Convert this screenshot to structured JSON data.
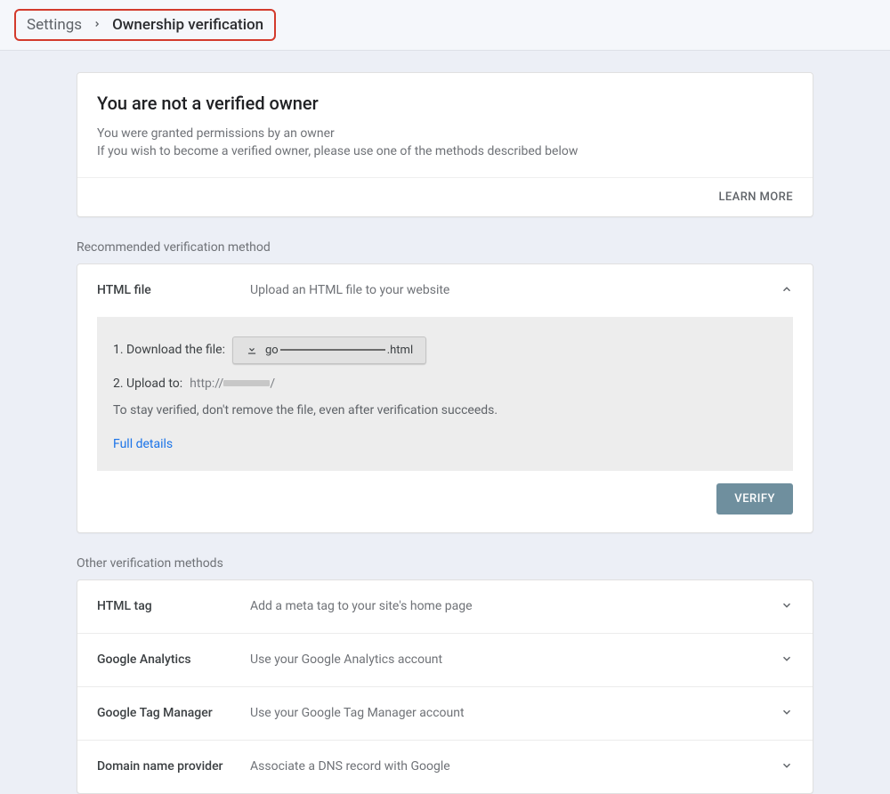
{
  "breadcrumb": {
    "settings": "Settings",
    "current": "Ownership verification"
  },
  "status": {
    "title": "You are not a verified owner",
    "line1": "You were granted permissions by an owner",
    "line2": "If you wish to become a verified owner, please use one of the methods described below",
    "learn_more": "LEARN MORE"
  },
  "recommended": {
    "label": "Recommended verification method",
    "title": "HTML file",
    "desc": "Upload an HTML file to your website",
    "step1_prefix": "1. Download the file:",
    "file_prefix": "go",
    "file_suffix": ".html",
    "step2_prefix": "2. Upload to:",
    "step2_url": "http://",
    "note": "To stay verified, don't remove the file, even after verification succeeds.",
    "full_details": "Full details",
    "verify": "VERIFY"
  },
  "other": {
    "label": "Other verification methods",
    "methods": [
      {
        "title": "HTML tag",
        "desc": "Add a meta tag to your site's home page"
      },
      {
        "title": "Google Analytics",
        "desc": "Use your Google Analytics account"
      },
      {
        "title": "Google Tag Manager",
        "desc": "Use your Google Tag Manager account"
      },
      {
        "title": "Domain name provider",
        "desc": "Associate a DNS record with Google"
      }
    ]
  }
}
